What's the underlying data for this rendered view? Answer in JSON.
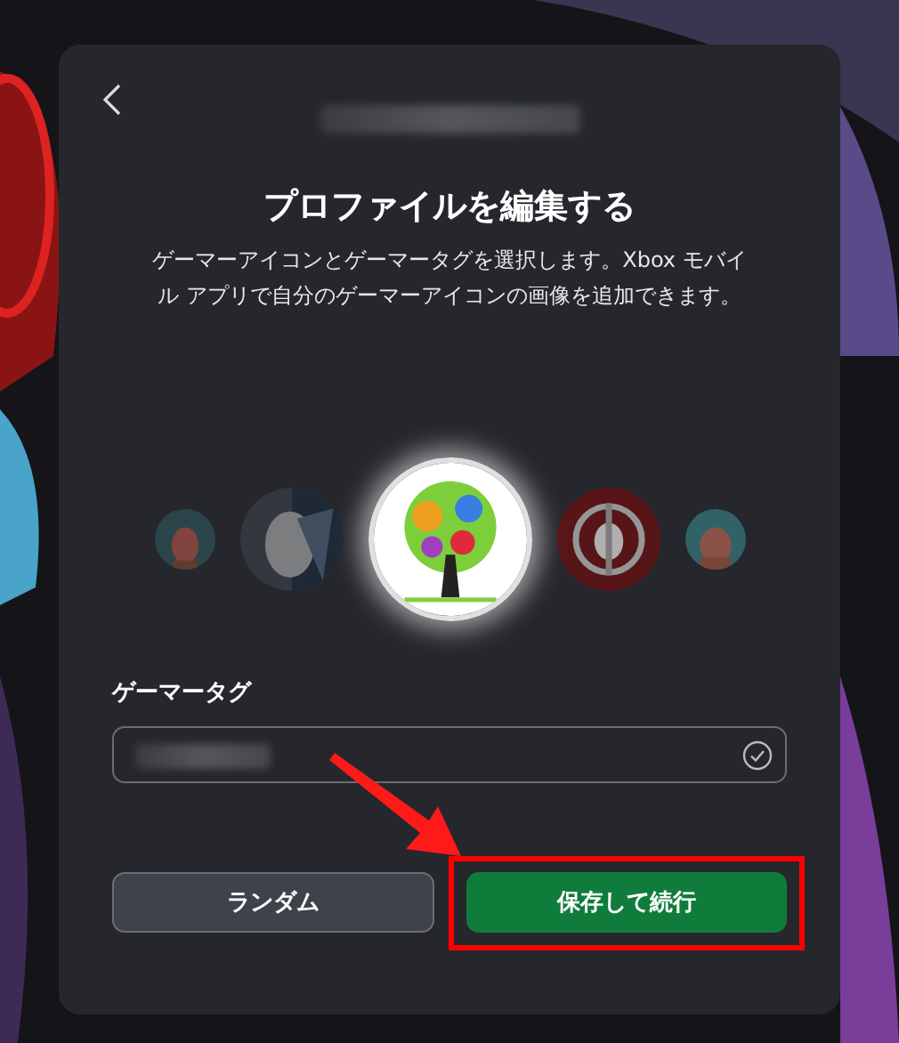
{
  "dialog": {
    "title": "プロファイルを編集する",
    "description": "ゲーマーアイコンとゲーマータグを選択します。Xbox モバイル アプリで自分のゲーマーアイコンの画像を追加できます。"
  },
  "avatars": [
    {
      "kind": "picture",
      "selected": false
    },
    {
      "kind": "picture",
      "selected": false
    },
    {
      "kind": "picture",
      "selected": true
    },
    {
      "kind": "picture",
      "selected": false
    },
    {
      "kind": "picture",
      "selected": false
    }
  ],
  "gamertag": {
    "label": "ゲーマータグ",
    "valid": true
  },
  "buttons": [
    {
      "label": "ランダム",
      "kind": "secondary",
      "highlighted": false
    },
    {
      "label": "保存して続行",
      "kind": "primary",
      "highlighted": true
    }
  ]
}
